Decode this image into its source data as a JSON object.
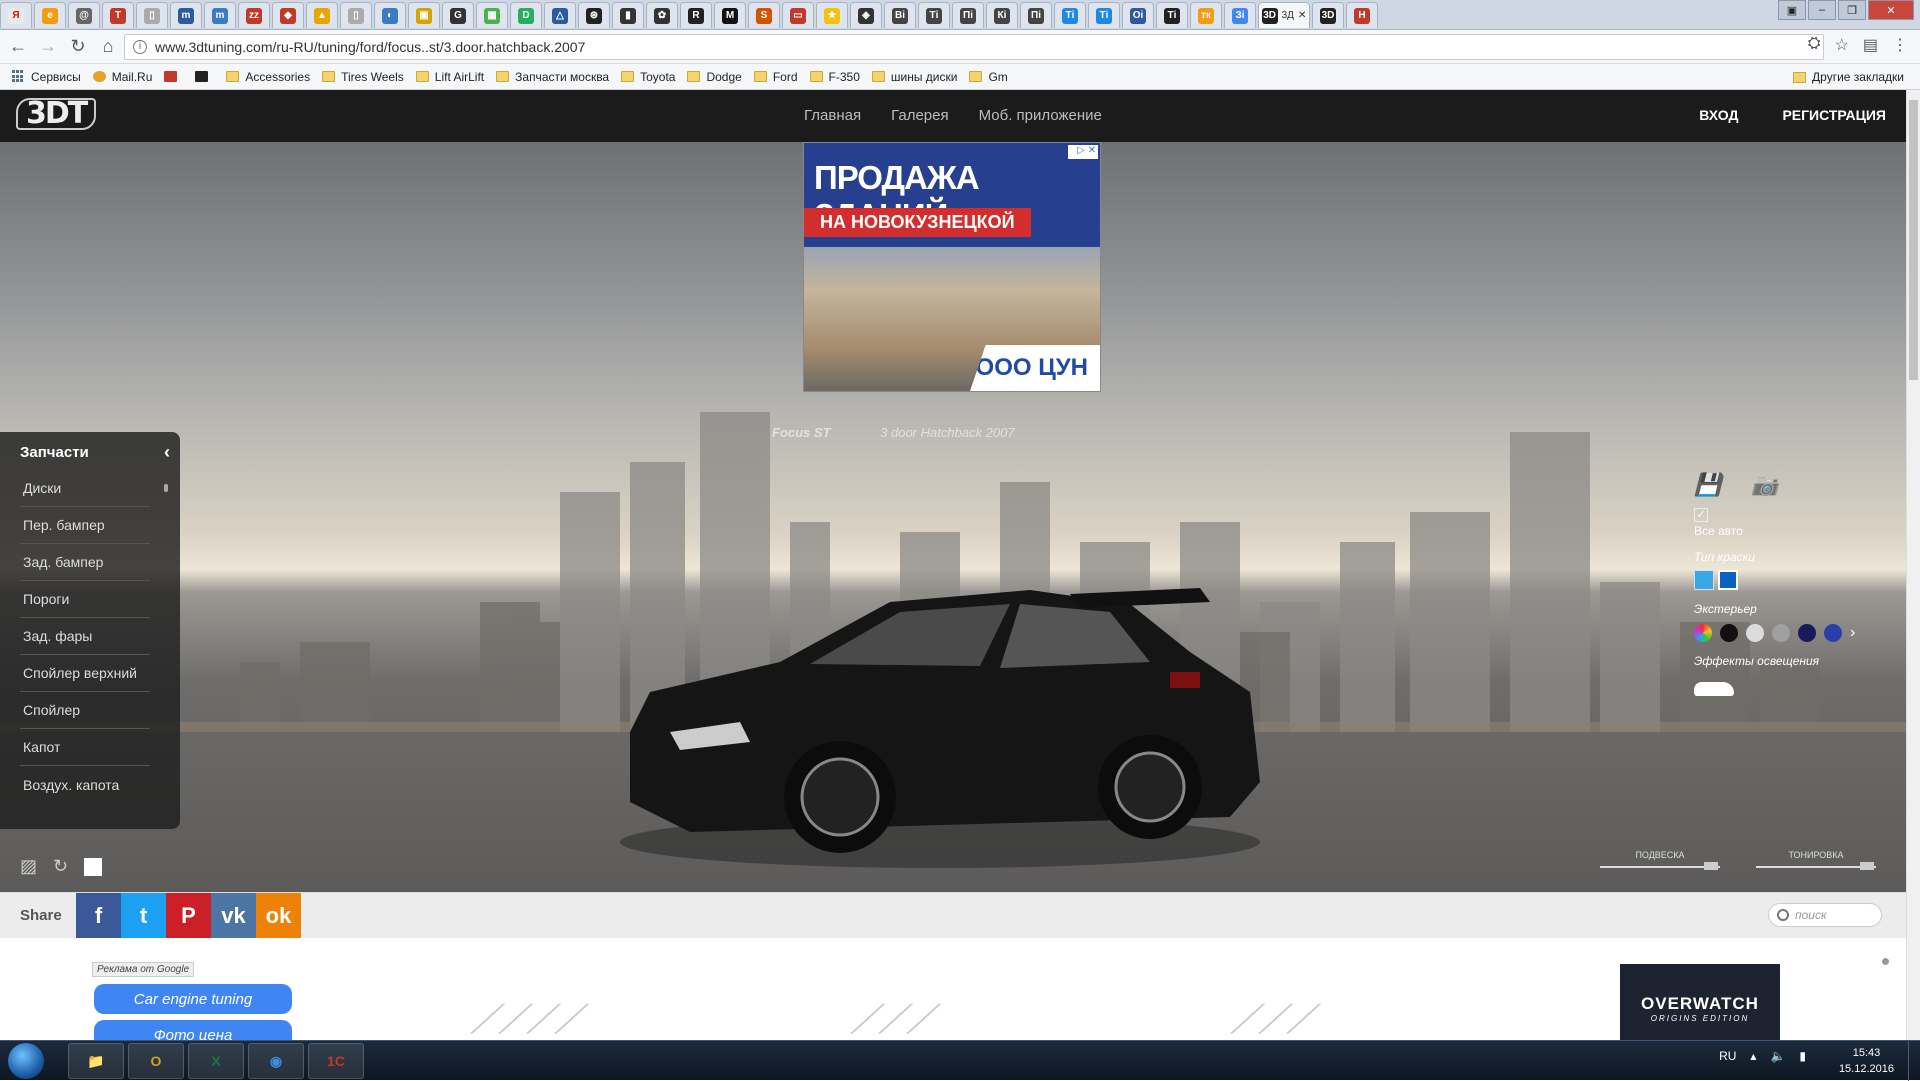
{
  "browser": {
    "tabs": [
      {
        "icon": "Я",
        "color": "#e9e9e9",
        "fg": "#d11"
      },
      {
        "icon": "e",
        "color": "#f39c12"
      },
      {
        "icon": "@",
        "color": "#666"
      },
      {
        "icon": "T",
        "color": "#c0392b"
      },
      {
        "icon": "▯",
        "color": "#aaa"
      },
      {
        "icon": "m",
        "color": "#2c5aa0"
      },
      {
        "icon": "m",
        "color": "#3b7bbf"
      },
      {
        "icon": "zz",
        "color": "#c0392b"
      },
      {
        "icon": "◆",
        "color": "#c0392b"
      },
      {
        "icon": "▲",
        "color": "#e6a800"
      },
      {
        "icon": "▯",
        "color": "#aaa"
      },
      {
        "icon": "◐",
        "color": "#3b7bbf"
      },
      {
        "icon": "▣",
        "color": "#d6a300"
      },
      {
        "icon": "G",
        "color": "#333"
      },
      {
        "icon": "▦",
        "color": "#4caf50"
      },
      {
        "icon": "D",
        "color": "#27ae60"
      },
      {
        "icon": "△",
        "color": "#2c5aa0"
      },
      {
        "icon": "⊛",
        "color": "#222"
      },
      {
        "icon": "▮",
        "color": "#333"
      },
      {
        "icon": "✿",
        "color": "#333"
      },
      {
        "icon": "R",
        "color": "#222"
      },
      {
        "icon": "M",
        "color": "#111"
      },
      {
        "icon": "S",
        "color": "#d35400"
      },
      {
        "icon": "▭",
        "color": "#c0392b"
      },
      {
        "icon": "★",
        "color": "#f1c40f"
      },
      {
        "icon": "◈",
        "color": "#333"
      },
      {
        "icon": "Вi",
        "color": "#444"
      },
      {
        "icon": "Тi",
        "color": "#444"
      },
      {
        "icon": "Пi",
        "color": "#444"
      },
      {
        "icon": "Кi",
        "color": "#444"
      },
      {
        "icon": "Пi",
        "color": "#444"
      },
      {
        "icon": "Тi",
        "color": "#1e88e5"
      },
      {
        "icon": "Тi",
        "color": "#1e88e5"
      },
      {
        "icon": "Оi",
        "color": "#2c5aa0"
      },
      {
        "icon": "Тi",
        "color": "#222"
      },
      {
        "icon": "тк",
        "color": "#f39c12"
      },
      {
        "icon": "Зi",
        "color": "#4285f4"
      },
      {
        "icon": "3D",
        "color": "#222"
      },
      {
        "icon": "3D",
        "color": "#222"
      },
      {
        "icon": "Н",
        "color": "#c0392b"
      }
    ],
    "active_tab_label": "3Д",
    "url": "www.3dtuning.com/ru-RU/tuning/ford/focus..st/3.door.hatchback.2007",
    "bookmarks": [
      {
        "label": "Сервисы",
        "kind": "apps"
      },
      {
        "label": "Mail.Ru",
        "kind": "site"
      },
      {
        "label": "",
        "kind": "car"
      },
      {
        "label": "",
        "kind": "warn"
      },
      {
        "label": "Accessories",
        "kind": "folder"
      },
      {
        "label": "Tires Weels",
        "kind": "folder"
      },
      {
        "label": "Lift AirLift",
        "kind": "folder"
      },
      {
        "label": "Запчасти москва",
        "kind": "folder"
      },
      {
        "label": "Toyota",
        "kind": "folder"
      },
      {
        "label": "Dodge",
        "kind": "folder"
      },
      {
        "label": "Ford",
        "kind": "folder"
      },
      {
        "label": "F-350",
        "kind": "folder"
      },
      {
        "label": "шины диски",
        "kind": "folder"
      },
      {
        "label": "Gm",
        "kind": "folder"
      }
    ],
    "other_bookmarks": "Другие закладки"
  },
  "site": {
    "logo": "3DT",
    "nav": [
      "Главная",
      "Галерея",
      "Моб. приложение"
    ],
    "login": "ВХОД",
    "register": "РЕГИСТРАЦИЯ"
  },
  "ad": {
    "title": "ПРОДАЖА ЗДАНИЙ",
    "subtitle": "НА НОВОКУЗНЕЦКОЙ",
    "badge": "ООО ЦУН",
    "close": "▷ ✕"
  },
  "car": {
    "brand_logo": "Focus ST",
    "model_caption": "3 door Hatchback 2007"
  },
  "parts": {
    "title": "Запчасти",
    "items": [
      "Диски",
      "Пер. бампер",
      "Зад. бампер",
      "Пороги",
      "Зад. фары",
      "Спойлер верхний",
      "Спойлер",
      "Капот",
      "Воздух. капота"
    ]
  },
  "controls": {
    "all_cars": "Все авто",
    "paint_type": "Тип краски",
    "exterior": "Экстерьер",
    "lighting": "Эффекты освещения",
    "slider_suspension": "ПОДВЕСКА",
    "slider_tint": "ТОНИРОВКА",
    "swatches": [
      "#cc4b9c",
      "#111111",
      "#dcdcdc",
      "#a0a0a0",
      "#1a1a5a",
      "#2c3fa8"
    ],
    "paint_colors": [
      "#3aa7e6",
      "#0a61c2"
    ]
  },
  "share": {
    "label": "Share",
    "networks": [
      {
        "label": "f",
        "color": "#3b5998"
      },
      {
        "label": "t",
        "color": "#1da1f2"
      },
      {
        "label": "P",
        "color": "#cb2027"
      },
      {
        "label": "vk",
        "color": "#4c75a3"
      },
      {
        "label": "ok",
        "color": "#ee8208"
      }
    ],
    "search_placeholder": "поиск"
  },
  "bottom": {
    "google_ads": "Реклама от Google",
    "ad_links": [
      "Car engine tuning",
      "Фото цена"
    ],
    "overwatch": "OVERWATCH",
    "overwatch_sub": "ORIGINS EDITION"
  },
  "taskbar": {
    "lang": "RU",
    "time": "15:43",
    "date": "15.12.2016",
    "apps": [
      "📁",
      "O",
      "X",
      "◉",
      "1С"
    ]
  }
}
